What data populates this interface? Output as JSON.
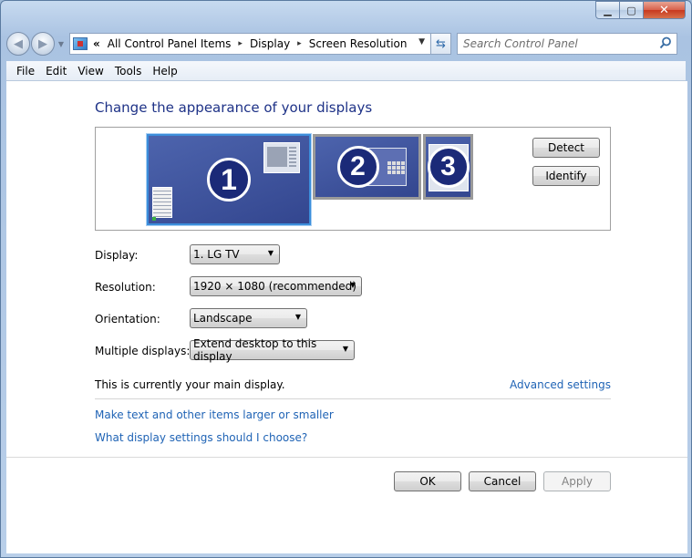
{
  "window": {
    "caption_buttons": {
      "minimize": "▁",
      "maximize": "▢",
      "close": "✕"
    }
  },
  "address": {
    "chevron": "«",
    "crumbs": [
      "All Control Panel Items",
      "Display",
      "Screen Resolution"
    ],
    "separator": "▸"
  },
  "search": {
    "placeholder": "Search Control Panel"
  },
  "menu": [
    "File",
    "Edit",
    "View",
    "Tools",
    "Help"
  ],
  "page": {
    "title": "Change the appearance of your displays",
    "monitors": [
      "1",
      "2",
      "3"
    ],
    "detect_label": "Detect",
    "identify_label": "Identify",
    "fields": {
      "display_label": "Display:",
      "display_value": "1. LG TV",
      "resolution_label": "Resolution:",
      "resolution_value": "1920 × 1080 (recommended)",
      "orientation_label": "Orientation:",
      "orientation_value": "Landscape",
      "multiple_label": "Multiple displays:",
      "multiple_value": "Extend desktop to this display"
    },
    "status_text": "This is currently your main display.",
    "advanced_link": "Advanced settings",
    "link_text_size": "Make text and other items larger or smaller",
    "link_help": "What display settings should I choose?"
  },
  "footer": {
    "ok": "OK",
    "cancel": "Cancel",
    "apply": "Apply"
  },
  "colors": {
    "link": "#1f63b5",
    "title": "#1e3287",
    "selected_border": "#3c8edb"
  }
}
